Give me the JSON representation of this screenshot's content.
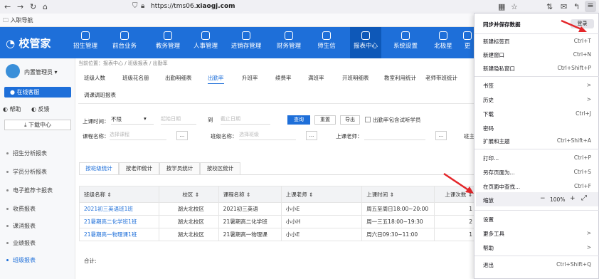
{
  "browser": {
    "url_prefix": "https://tms06.",
    "url_domain": "xiaogj.com",
    "bookmark": "入职导航"
  },
  "app": {
    "logo": "校管家",
    "nav": [
      "招生管理",
      "前台业务",
      "教务管理",
      "人事管理",
      "进销存管理",
      "财务管理",
      "师生信",
      "报表中心",
      "系统设置",
      "北极星",
      "更"
    ],
    "active_nav": "报表中心"
  },
  "sidebar": {
    "user": "内置管理员",
    "online": "在线客服",
    "help": "帮助",
    "feedback": "反馈",
    "download": "下载中心",
    "items": [
      "招生分析报表",
      "学员分析报表",
      "电子推荐卡报表",
      "收费报表",
      "课消报表",
      "业绩报表",
      "班级报表"
    ]
  },
  "breadcrumb": "当前位置：报表中心 / 班级报表 / 出勤率",
  "tabs": [
    "班级人数",
    "班级花名册",
    "出勤明细表",
    "出勤率",
    "升班率",
    "续费率",
    "满班率",
    "开班明细表",
    "教室利用统计",
    "老师带班统计"
  ],
  "tab2": "调课调班报表",
  "filters": {
    "time_label": "上课时间：",
    "time_value": "不限",
    "start_ph": "起始日期",
    "to": "到",
    "end_ph": "截止日期",
    "query": "查询",
    "reset": "重置",
    "export": "导出",
    "include_trial": "出勤率包含试听学员",
    "course_label": "课程名称：",
    "course_ph": "选择课程",
    "class_label": "班级名称：",
    "class_ph": "选择班级",
    "teacher_label": "上课老师：",
    "more": "...",
    "cut_label": "班主"
  },
  "subtabs": [
    "按班级统计",
    "按老师统计",
    "按学员统计",
    "按校区统计"
  ],
  "table": {
    "headers": [
      "班级名称 ⇕",
      "校区 ⇕",
      "课程名称 ⇕",
      "上课老师 ⇕",
      "上课时间 ⇕",
      "上课次数 ⇕"
    ],
    "rows": [
      [
        "2021初三英语班1班",
        "湖大北校区",
        "2021初三英语",
        "小小E",
        "周五至周日18:00~20:00",
        "1"
      ],
      [
        "21暑期高二化学班1班",
        "湖大北校区",
        "21暑期高二化学班",
        "小小H",
        "周一三五18:00~19:30",
        "2"
      ],
      [
        "21暑期高一物理课1班",
        "湖大北校区",
        "21暑期高一物理课",
        "小小E",
        "周六日09:30~11:00",
        "1"
      ]
    ],
    "total": "合计:"
  },
  "menu": {
    "sync": "同步并保存数据",
    "signin": "登录",
    "items": [
      {
        "label": "新建标签页",
        "shortcut": "Ctrl+T"
      },
      {
        "label": "新建窗口",
        "shortcut": "Ctrl+N"
      },
      {
        "label": "新建隐私窗口",
        "shortcut": "Ctrl+Shift+P"
      },
      {
        "label": "书签",
        "shortcut": ">"
      },
      {
        "label": "历史",
        "shortcut": ">"
      },
      {
        "label": "下载",
        "shortcut": "Ctrl+J"
      },
      {
        "label": "密码",
        "shortcut": ""
      },
      {
        "label": "扩展和主题",
        "shortcut": "Ctrl+Shift+A"
      },
      {
        "label": "打印...",
        "shortcut": "Ctrl+P"
      },
      {
        "label": "另存页面为...",
        "shortcut": "Ctrl+S"
      },
      {
        "label": "在页面中查找...",
        "shortcut": "Ctrl+F"
      },
      {
        "label": "缩放",
        "shortcut": ""
      },
      {
        "label": "设置",
        "shortcut": ""
      },
      {
        "label": "更多工具",
        "shortcut": ">"
      },
      {
        "label": "帮助",
        "shortcut": ">"
      },
      {
        "label": "退出",
        "shortcut": "Ctrl+Shift+Q"
      }
    ],
    "zoom_minus": "−",
    "zoom_value": "100%",
    "zoom_plus": "+",
    "zoom_full": "⤢"
  },
  "colors": {
    "brand": "#1e6fd9",
    "arrow": "#e4262a"
  }
}
